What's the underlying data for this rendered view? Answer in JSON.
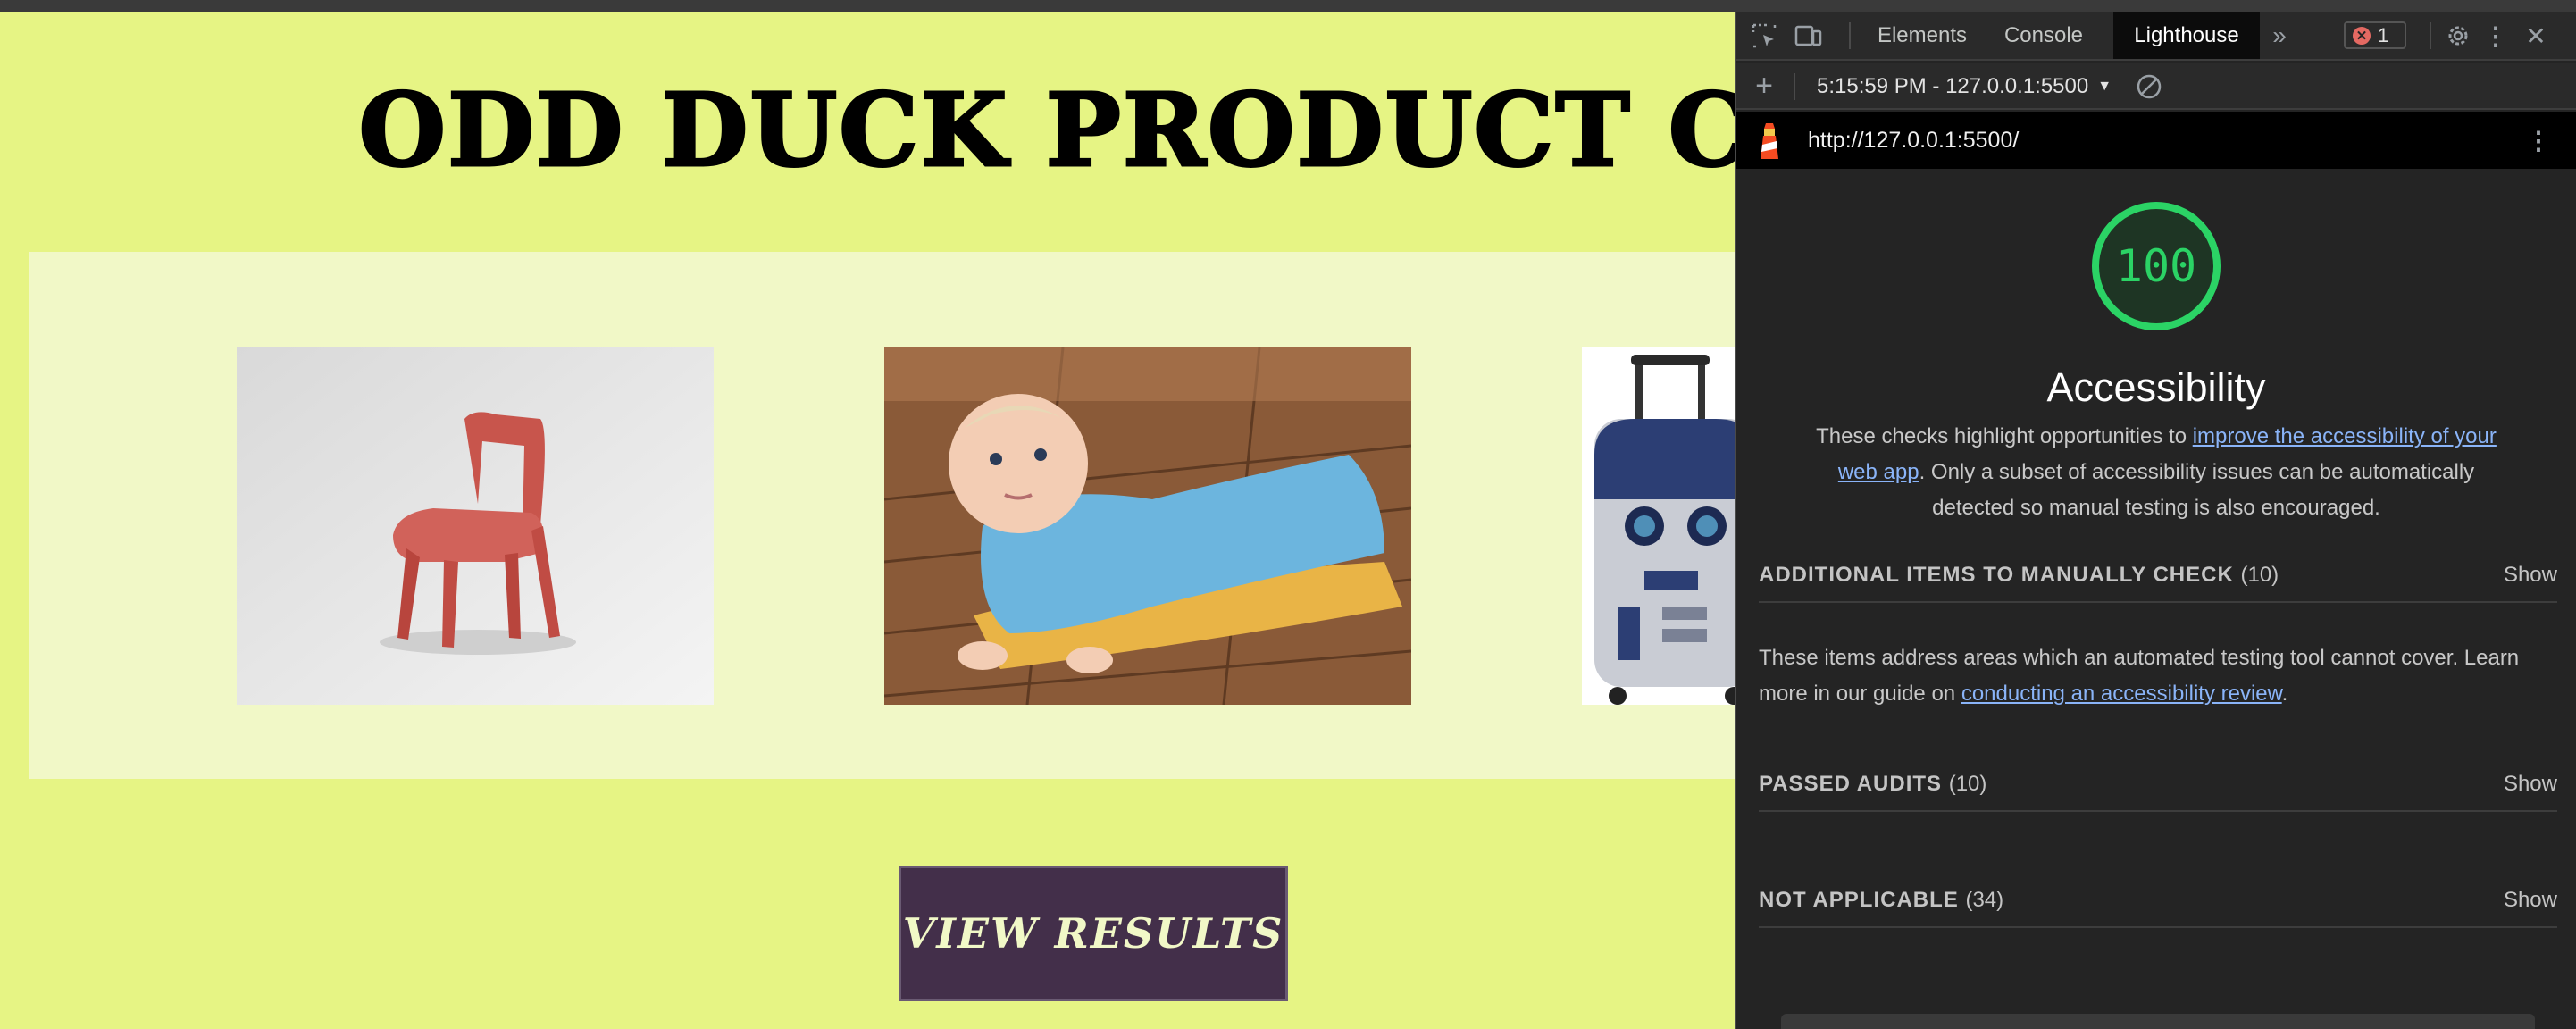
{
  "page": {
    "title": "ODD DUCK PRODUCT CO",
    "results_button": "VIEW RESULTS",
    "products": [
      {
        "name": "chair"
      },
      {
        "name": "baby-sweep"
      },
      {
        "name": "r2d2-bag"
      }
    ],
    "colors": {
      "background": "#e6f484",
      "gallery": "#f1f8c7",
      "button": "#432f4a"
    }
  },
  "devtools": {
    "tabs": [
      {
        "label": "Elements",
        "active": false
      },
      {
        "label": "Console",
        "active": false
      },
      {
        "label": "Lighthouse",
        "active": true
      }
    ],
    "error_count": "1",
    "report_select": "5:15:59 PM - 127.0.0.1:5500",
    "url": "http://127.0.0.1:5500/",
    "score": "100",
    "category_title": "Accessibility",
    "description": {
      "before": "These checks highlight opportunities to ",
      "link": "improve the accessibility of your web app",
      "after": ". Only a subset of accessibility issues can be automatically detected so manual testing is also encouraged."
    },
    "groups": [
      {
        "title": "ADDITIONAL ITEMS TO MANUALLY CHECK",
        "count": "(10)",
        "action": "Show"
      },
      {
        "title": "PASSED AUDITS",
        "count": "(10)",
        "action": "Show"
      },
      {
        "title": "NOT APPLICABLE",
        "count": "(34)",
        "action": "Show"
      }
    ],
    "manual_note": {
      "before": "These items address areas which an automated testing tool cannot cover. Learn more in our guide on ",
      "link": "conducting an accessibility review",
      "after": "."
    },
    "colors": {
      "score": "#2bd365",
      "link": "#8ab4f8",
      "panel": "#242424"
    }
  }
}
